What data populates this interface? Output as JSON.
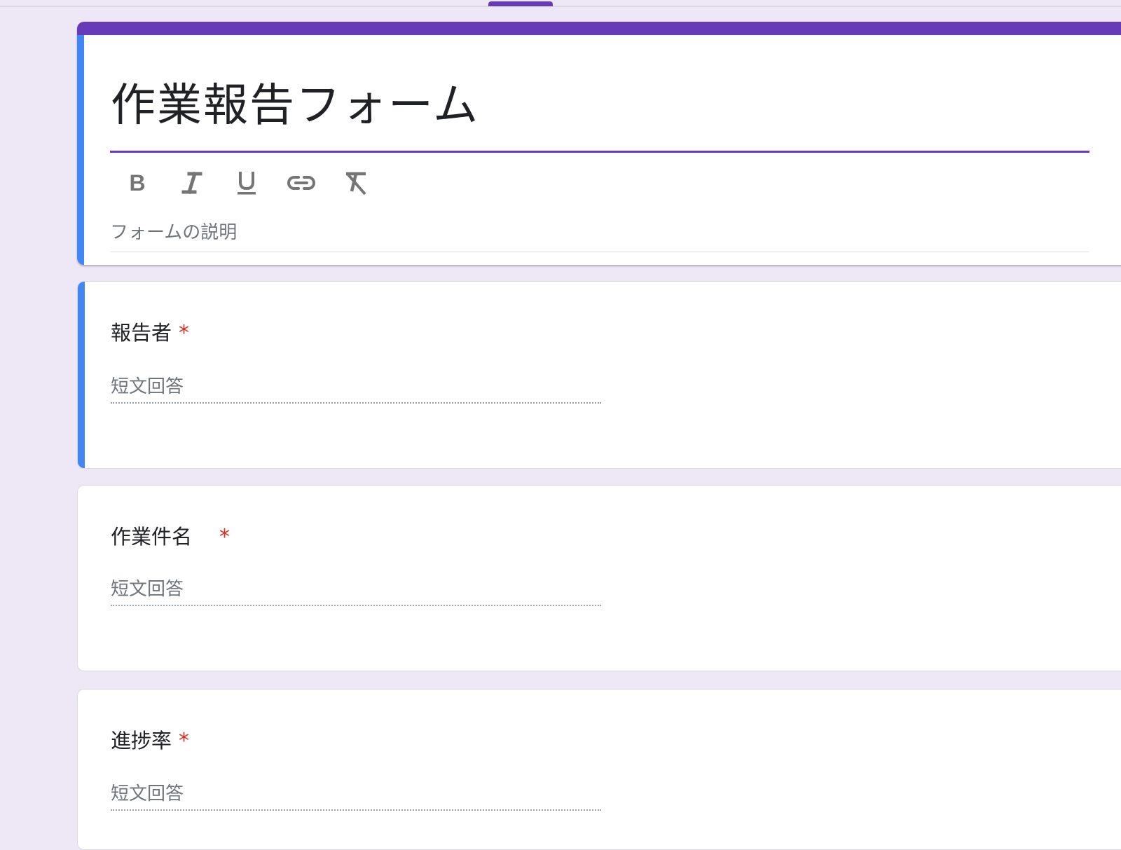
{
  "form": {
    "title": "作業報告フォーム",
    "description_placeholder": "フォームの説明"
  },
  "toolbar": {
    "buttons": [
      {
        "name": "bold",
        "icon": "bold-icon"
      },
      {
        "name": "italic",
        "icon": "italic-icon"
      },
      {
        "name": "underline",
        "icon": "underline-icon"
      },
      {
        "name": "link",
        "icon": "link-icon"
      },
      {
        "name": "clear-formatting",
        "icon": "clear-format-icon"
      }
    ]
  },
  "questions": [
    {
      "label": "報告者",
      "required_mark": "*",
      "answer_placeholder": "短文回答"
    },
    {
      "label": "作業件名　",
      "required_mark": "*",
      "answer_placeholder": "短文回答"
    },
    {
      "label": "進捗率",
      "required_mark": "*",
      "answer_placeholder": "短文回答"
    }
  ],
  "colors": {
    "theme": "#673ab7",
    "active_accent": "#4285f4",
    "background": "#ede7f6",
    "required": "#d93025"
  }
}
